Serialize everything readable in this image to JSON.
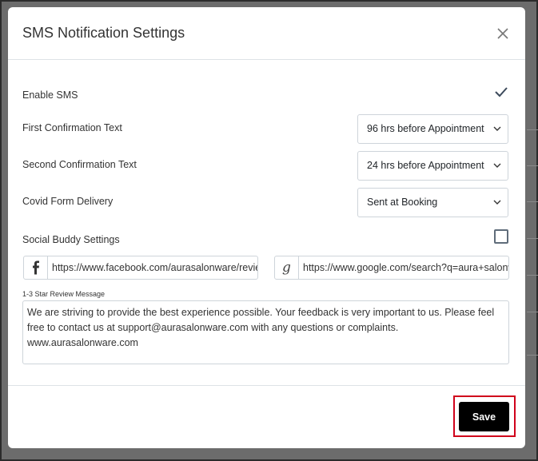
{
  "modal": {
    "title": "SMS Notification Settings",
    "close_icon": "close-icon"
  },
  "enable_sms": {
    "label": "Enable SMS",
    "checked": true,
    "icon": "check-icon"
  },
  "first_confirmation": {
    "label": "First Confirmation Text",
    "value": "96 hrs before Appointment"
  },
  "second_confirmation": {
    "label": "Second Confirmation Text",
    "value": "24 hrs before Appointment"
  },
  "covid_form": {
    "label": "Covid Form Delivery",
    "value": "Sent at Booking"
  },
  "social_buddy": {
    "label": "Social Buddy Settings",
    "checked": false,
    "facebook": {
      "icon": "facebook-icon",
      "value": "https://www.facebook.com/aurasalonware/reviews"
    },
    "google": {
      "icon": "google-icon",
      "value": "https://www.google.com/search?q=aura+salonware"
    }
  },
  "review_message": {
    "label": "1-3 Star Review Message",
    "value": "We are striving to provide the best experience possible. Your feedback is very important to us. Please feel free to contact us at support@aurasalonware.com with any questions or complaints. www.aurasalonware.com"
  },
  "footer": {
    "save_label": "Save",
    "highlight_color": "#d0021b"
  }
}
